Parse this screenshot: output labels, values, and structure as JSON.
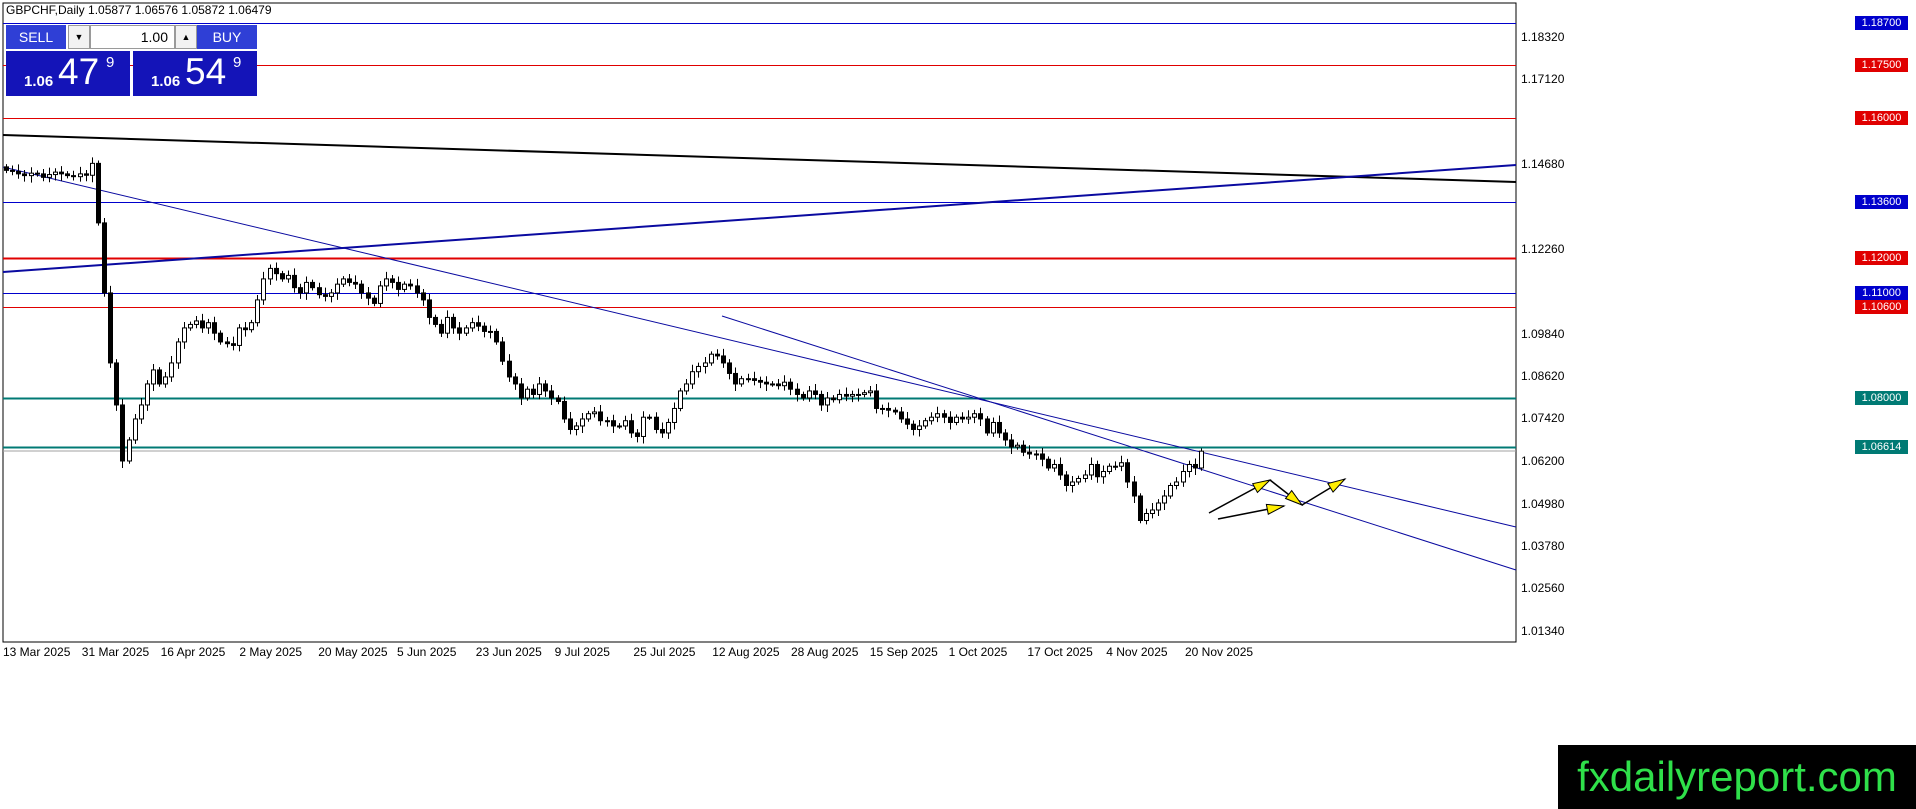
{
  "header": {
    "symbol_line": "GBPCHF,Daily  1.05877 1.06576 1.05872 1.06479"
  },
  "trade_panel": {
    "sell_label": "SELL",
    "buy_label": "BUY",
    "lot_value": "1.00",
    "bid_prefix": "1.06",
    "bid_big": "47",
    "bid_sup": "9",
    "ask_prefix": "1.06",
    "ask_big": "54",
    "ask_sup": "9"
  },
  "brand_text": "fxdailyreport.com",
  "colors": {
    "red_level": "#e00000",
    "blue_level": "#0000cc",
    "teal_level": "#007a74",
    "channel": "#0a0aa0",
    "panel": "#1414b8",
    "arrow_fill": "#ffee00",
    "brand_green": "#2fe04a"
  },
  "chart_data": {
    "type": "candlestick",
    "symbol": "GBPCHF",
    "timeframe": "Daily",
    "ylim": [
      1.0103,
      1.1928
    ],
    "y_ticks": [
      "1.18320",
      "1.17120",
      "1.14680",
      "1.12260",
      "1.09840",
      "1.08620",
      "1.07420",
      "1.06200",
      "1.04980",
      "1.03780",
      "1.02560",
      "1.01340"
    ],
    "x_ticks": [
      "13 Mar 2025",
      "31 Mar 2025",
      "16 Apr 2025",
      "2 May 2025",
      "20 May 2025",
      "5 Jun 2025",
      "23 Jun 2025",
      "9 Jul 2025",
      "25 Jul 2025",
      "12 Aug 2025",
      "28 Aug 2025",
      "15 Sep 2025",
      "1 Oct 2025",
      "17 Oct 2025",
      "4 Nov 2025",
      "20 Nov 2025"
    ],
    "levels": [
      {
        "price": 1.187,
        "label": "1.18700",
        "color": "blue"
      },
      {
        "price": 1.175,
        "label": "1.17500",
        "color": "red"
      },
      {
        "price": 1.16,
        "label": "1.16000",
        "color": "red"
      },
      {
        "price": 1.136,
        "label": "1.13600",
        "color": "blue"
      },
      {
        "price": 1.12,
        "label": "1.12000",
        "color": "red"
      },
      {
        "price": 1.11,
        "label": "1.11000",
        "color": "blue"
      },
      {
        "price": 1.106,
        "label": "1.10600",
        "color": "red"
      },
      {
        "price": 1.08,
        "label": "1.08000",
        "color": "teal"
      },
      {
        "price": 1.0661,
        "label": "1.06614",
        "color": "teal"
      }
    ],
    "close_series": [
      1.145,
      1.1447,
      1.144,
      1.1435,
      1.1442,
      1.144,
      1.143,
      1.1438,
      1.1445,
      1.144,
      1.1435,
      1.1432,
      1.144,
      1.1436,
      1.147,
      1.13,
      1.11,
      1.09,
      1.078,
      1.062,
      1.068,
      1.074,
      1.078,
      1.084,
      1.088,
      1.084,
      1.086,
      1.09,
      1.096,
      1.1,
      1.101,
      1.102,
      1.1,
      1.1015,
      1.0985,
      1.096,
      1.0955,
      1.095,
      1.1,
      1.0995,
      1.1015,
      1.108,
      1.114,
      1.117,
      1.1155,
      1.114,
      1.115,
      1.1115,
      1.11,
      1.113,
      1.1115,
      1.1095,
      1.109,
      1.11,
      1.1125,
      1.114,
      1.113,
      1.1125,
      1.11,
      1.1085,
      1.107,
      1.112,
      1.114,
      1.113,
      1.111,
      1.1125,
      1.112,
      1.11,
      1.108,
      1.103,
      1.101,
      1.0985,
      1.103,
      1.1,
      1.0985,
      1.1,
      1.1015,
      1.1005,
      1.099,
      1.099,
      1.096,
      1.0905,
      1.086,
      1.084,
      1.08,
      1.0825,
      1.081,
      1.084,
      1.082,
      1.08,
      1.079,
      1.074,
      1.071,
      1.072,
      1.074,
      1.0755,
      1.076,
      1.0735,
      1.0735,
      1.072,
      1.072,
      1.0735,
      1.07,
      1.069,
      1.0745,
      1.0745,
      1.071,
      1.07,
      1.073,
      1.077,
      1.082,
      1.084,
      1.0875,
      1.089,
      1.09,
      1.0925,
      1.092,
      1.09,
      1.087,
      1.084,
      1.0855,
      1.0855,
      1.085,
      1.0845,
      1.084,
      1.084,
      1.0835,
      1.0845,
      1.0825,
      1.081,
      1.08,
      1.082,
      1.081,
      1.078,
      1.08,
      1.0795,
      1.081,
      1.0805,
      1.081,
      1.081,
      1.0815,
      1.082,
      1.077,
      1.077,
      1.0765,
      1.076,
      1.074,
      1.0725,
      1.071,
      1.072,
      1.0735,
      1.0745,
      1.0755,
      1.0745,
      1.073,
      1.0745,
      1.074,
      1.0745,
      1.0755,
      1.074,
      1.07,
      1.073,
      1.07,
      1.068,
      1.066,
      1.0665,
      1.0645,
      1.064,
      1.064,
      1.0625,
      1.06,
      1.061,
      1.058,
      1.055,
      1.056,
      1.057,
      1.058,
      1.061,
      1.0575,
      1.059,
      1.0605,
      1.0605,
      1.0615,
      1.056,
      1.052,
      1.045,
      1.047,
      1.048,
      1.05,
      1.052,
      1.055,
      1.056,
      1.059,
      1.061,
      1.06,
      1.0648
    ]
  }
}
